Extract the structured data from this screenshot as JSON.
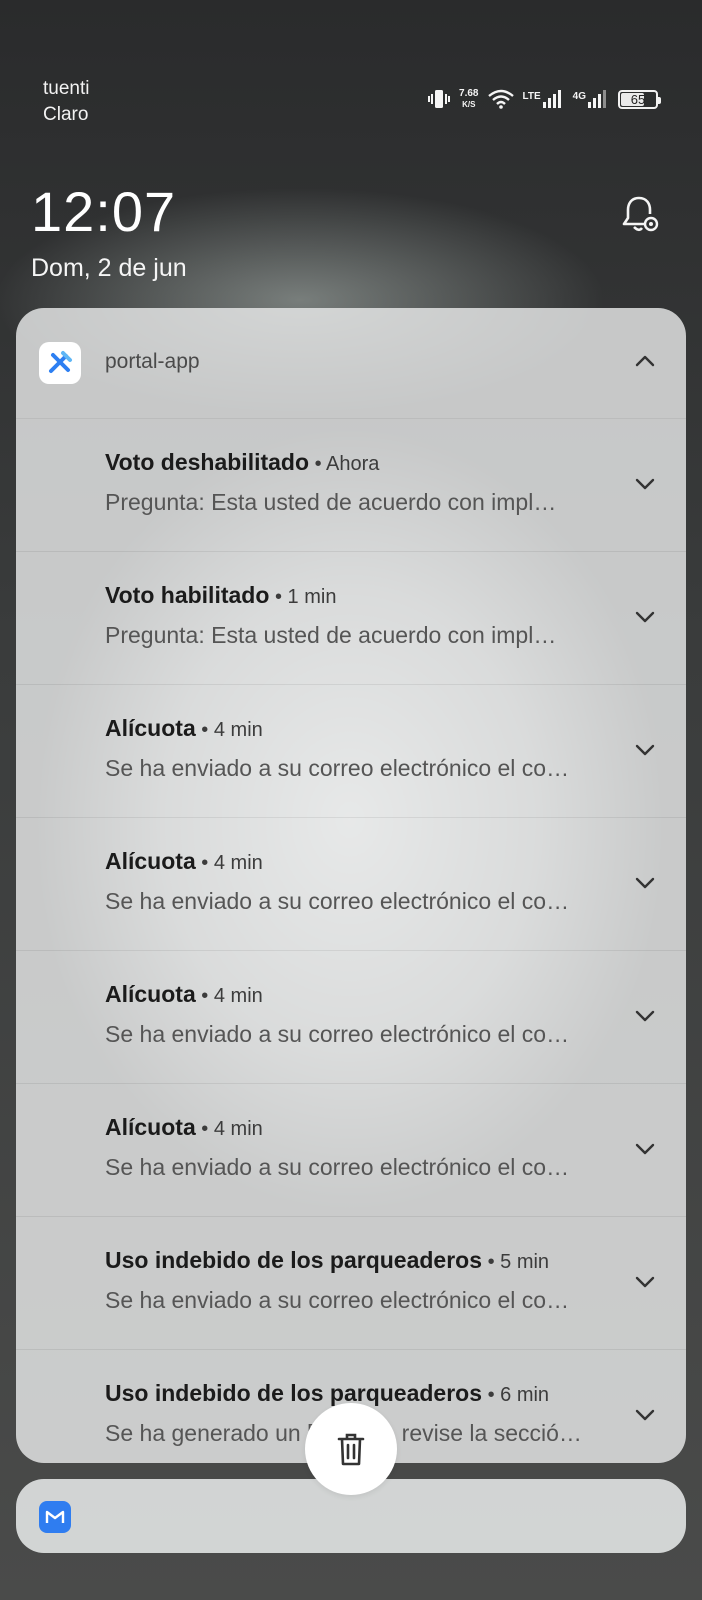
{
  "status_bar": {
    "carrier_line1": "tuenti",
    "carrier_line2": "Claro",
    "net_speed": "7.68",
    "net_speed_unit": "K/S",
    "lte_label": "LTE",
    "network_4g": "4G",
    "battery_level": "65",
    "icons": [
      "vibrate-icon",
      "wifi-icon",
      "lte-signal-icon",
      "4g-signal-icon",
      "battery-icon"
    ]
  },
  "lockscreen": {
    "time": "12:07",
    "date": "Dom, 2 de jun"
  },
  "notification_group": {
    "app_name": "portal-app",
    "app_icon": "portal-app-icon",
    "notifications": [
      {
        "title": "Voto deshabilitado",
        "time": "Ahora",
        "body": "Pregunta: Esta usted de acuerdo con impl…"
      },
      {
        "title": "Voto habilitado",
        "time": "1 min",
        "body": "Pregunta: Esta usted de acuerdo con impl…"
      },
      {
        "title": "Alícuota",
        "time": "4 min",
        "body": "Se ha enviado a su correo electrónico el co…"
      },
      {
        "title": "Alícuota",
        "time": "4 min",
        "body": "Se ha enviado a su correo electrónico el co…"
      },
      {
        "title": "Alícuota",
        "time": "4 min",
        "body": "Se ha enviado a su correo electrónico el co…"
      },
      {
        "title": "Alícuota",
        "time": "4 min",
        "body": "Se ha enviado a su correo electrónico el co…"
      },
      {
        "title": "Uso indebido de los parqueaderos",
        "time": "5 min",
        "body": "Se ha enviado a su correo electrónico el co…"
      },
      {
        "title": "Uso indebido de los parqueaderos",
        "time": "6 min",
        "body": "Se ha generado un [hidden], revise la secció…"
      }
    ]
  },
  "second_group": {
    "app_icon": "gmail-style-icon"
  },
  "colors": {
    "panel": "#e8e9e9",
    "accent_icon": "#2f7df0",
    "title_text": "#1b1b1b",
    "body_text": "#555555"
  }
}
